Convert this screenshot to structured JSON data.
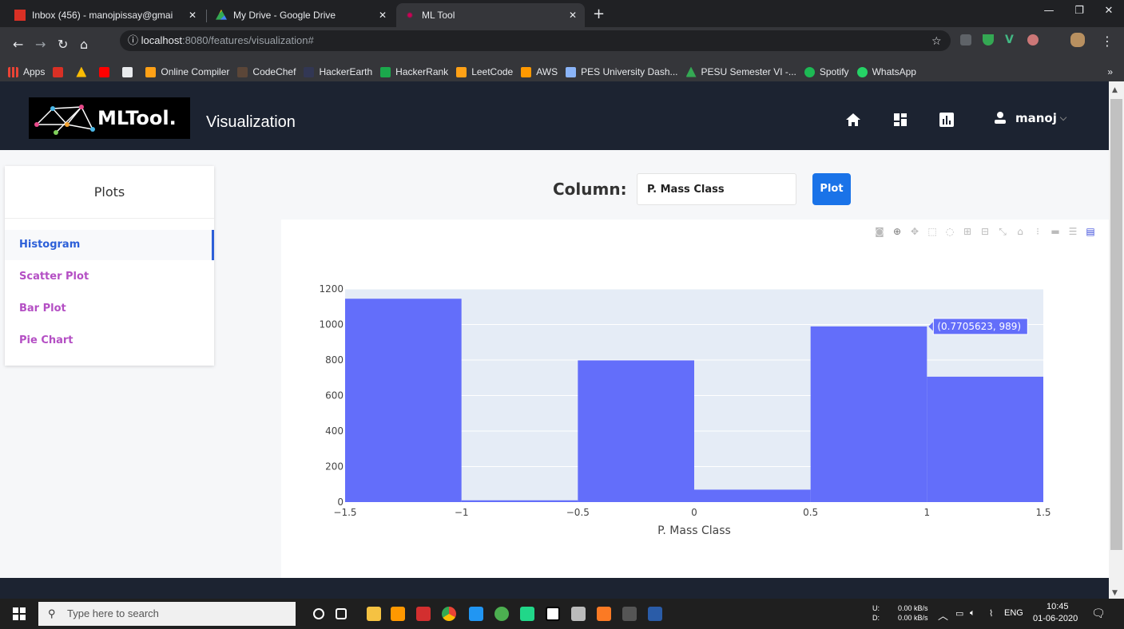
{
  "browser": {
    "tabs": [
      {
        "title": "Inbox (456) - manojpissay@gmai"
      },
      {
        "title": "My Drive - Google Drive"
      },
      {
        "title": "ML Tool"
      }
    ],
    "url_host": "localhost",
    "url_path": ":8080/features/visualization#",
    "bookmarks": [
      "Apps",
      "Online Compiler",
      "CodeChef",
      "HackerEarth",
      "HackerRank",
      "LeetCode",
      "AWS",
      "PES University Dash...",
      "PESU Semester VI -...",
      "Spotify",
      "WhatsApp"
    ],
    "bookmark_overflow": "»"
  },
  "header": {
    "logo_text": "MLTool.",
    "page_title": "Visualization",
    "user_name": "manoj"
  },
  "sidebar": {
    "title": "Plots",
    "items": [
      {
        "label": "Histogram",
        "active": true
      },
      {
        "label": "Scatter Plot",
        "active": false
      },
      {
        "label": "Bar Plot",
        "active": false
      },
      {
        "label": "Pie Chart",
        "active": false
      }
    ]
  },
  "controls": {
    "column_label": "Column:",
    "column_value": "P. Mass Class",
    "plot_button": "Plot"
  },
  "chart_data": {
    "type": "bar",
    "subtype": "histogram",
    "bins": [
      {
        "x0": -1.5,
        "x1": -1.0,
        "count": 1145
      },
      {
        "x0": -1.0,
        "x1": -0.5,
        "count": 10
      },
      {
        "x0": -0.5,
        "x1": 0.0,
        "count": 798
      },
      {
        "x0": 0.0,
        "x1": 0.5,
        "count": 70
      },
      {
        "x0": 0.5,
        "x1": 1.0,
        "count": 989
      },
      {
        "x0": 1.0,
        "x1": 1.5,
        "count": 706
      }
    ],
    "xlabel": "P. Mass Class",
    "ylabel": "",
    "xlim": [
      -1.5,
      1.5
    ],
    "ylim": [
      0,
      1200
    ],
    "xticks": [
      "−1.5",
      "−1",
      "−0.5",
      "0",
      "0.5",
      "1",
      "1.5"
    ],
    "xtick_values": [
      -1.5,
      -1,
      -0.5,
      0,
      0.5,
      1,
      1.5
    ],
    "yticks": [
      0,
      200,
      400,
      600,
      800,
      1000,
      1200
    ],
    "bar_color": "#636efa",
    "plot_bg": "#e5ecf6",
    "hover_label": "(0.7705623, 989)"
  },
  "taskbar": {
    "search_placeholder": "Type here to search",
    "net_up_label": "U:",
    "net_down_label": "D:",
    "net_up": "0.00 kB/s",
    "net_down": "0.00 kB/s",
    "lang": "ENG",
    "time": "10:45",
    "date": "01-06-2020"
  }
}
